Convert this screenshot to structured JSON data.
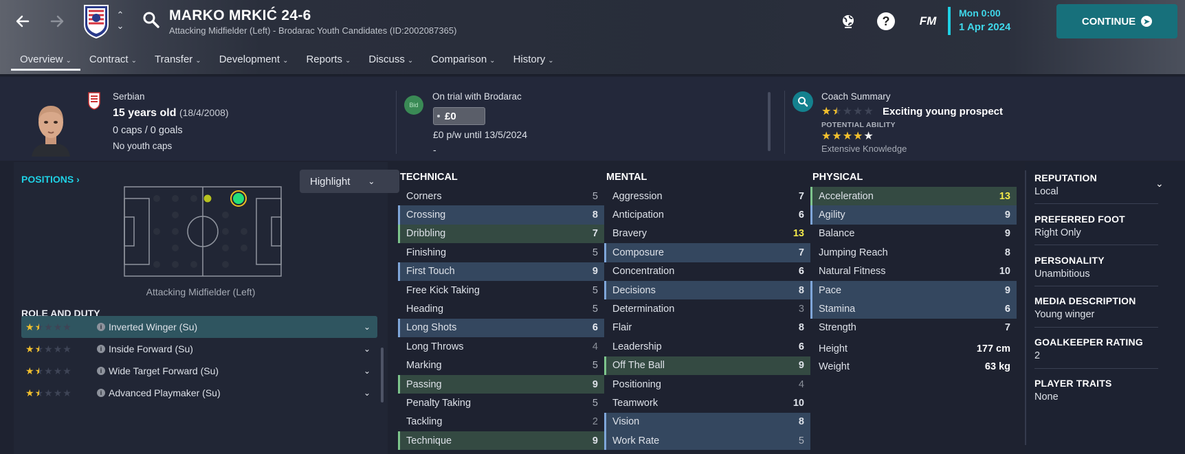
{
  "header": {
    "player_name": "MARKO MRKIĆ 24-6",
    "player_subtitle": "Attacking Midfielder (Left) - Brodarac Youth Candidates (ID:2002087365)",
    "date_day": "Mon 0:00",
    "date_date": "1 Apr 2024",
    "continue_label": "CONTINUE",
    "fm_label": "FM",
    "help_label": "?"
  },
  "tabs": [
    {
      "label": "Overview"
    },
    {
      "label": "Contract"
    },
    {
      "label": "Transfer"
    },
    {
      "label": "Development"
    },
    {
      "label": "Reports"
    },
    {
      "label": "Discuss"
    },
    {
      "label": "Comparison"
    },
    {
      "label": "History"
    }
  ],
  "info": {
    "nationality": "Serbian",
    "age": "15 years old",
    "dob": "(18/4/2008)",
    "caps": "0 caps / 0 goals",
    "youth_caps": "No youth caps",
    "bid_label": "Bid",
    "trial": "On trial with Brodarac",
    "fee": "£0",
    "wage": "£0 p/w until 13/5/2024",
    "dash": "-",
    "coach_title": "Coach Summary",
    "current_ability_text": "Exciting young prospect",
    "current_ability_stars": 1.5,
    "potential_label": "POTENTIAL ABILITY",
    "potential_stars": 4,
    "knowledge": "Extensive Knowledge"
  },
  "positions": {
    "link_label": "POSITIONS",
    "highlight_label": "Highlight",
    "caption": "Attacking Midfielder (Left)",
    "role_title": "ROLE AND DUTY",
    "roles": [
      {
        "name": "Inverted Winger (Su)",
        "stars": 1.5
      },
      {
        "name": "Inside Forward (Su)",
        "stars": 1.5
      },
      {
        "name": "Wide Target Forward (Su)",
        "stars": 1.5
      },
      {
        "name": "Advanced Playmaker (Su)",
        "stars": 1.5
      }
    ]
  },
  "technical": {
    "title": "TECHNICAL",
    "attrs": [
      {
        "name": "Corners",
        "value": "5",
        "hl": ""
      },
      {
        "name": "Crossing",
        "value": "8",
        "hl": "b"
      },
      {
        "name": "Dribbling",
        "value": "7",
        "hl": "g"
      },
      {
        "name": "Finishing",
        "value": "5",
        "hl": ""
      },
      {
        "name": "First Touch",
        "value": "9",
        "hl": "b"
      },
      {
        "name": "Free Kick Taking",
        "value": "5",
        "hl": ""
      },
      {
        "name": "Heading",
        "value": "5",
        "hl": ""
      },
      {
        "name": "Long Shots",
        "value": "6",
        "hl": "b"
      },
      {
        "name": "Long Throws",
        "value": "4",
        "hl": ""
      },
      {
        "name": "Marking",
        "value": "5",
        "hl": ""
      },
      {
        "name": "Passing",
        "value": "9",
        "hl": "g"
      },
      {
        "name": "Penalty Taking",
        "value": "5",
        "hl": ""
      },
      {
        "name": "Tackling",
        "value": "2",
        "hl": ""
      },
      {
        "name": "Technique",
        "value": "9",
        "hl": "g"
      }
    ]
  },
  "mental": {
    "title": "MENTAL",
    "attrs": [
      {
        "name": "Aggression",
        "value": "7",
        "hl": ""
      },
      {
        "name": "Anticipation",
        "value": "6",
        "hl": ""
      },
      {
        "name": "Bravery",
        "value": "13",
        "hl": ""
      },
      {
        "name": "Composure",
        "value": "7",
        "hl": "b"
      },
      {
        "name": "Concentration",
        "value": "6",
        "hl": ""
      },
      {
        "name": "Decisions",
        "value": "8",
        "hl": "b"
      },
      {
        "name": "Determination",
        "value": "3",
        "hl": ""
      },
      {
        "name": "Flair",
        "value": "8",
        "hl": ""
      },
      {
        "name": "Leadership",
        "value": "6",
        "hl": ""
      },
      {
        "name": "Off The Ball",
        "value": "9",
        "hl": "g"
      },
      {
        "name": "Positioning",
        "value": "4",
        "hl": ""
      },
      {
        "name": "Teamwork",
        "value": "10",
        "hl": ""
      },
      {
        "name": "Vision",
        "value": "8",
        "hl": "b"
      },
      {
        "name": "Work Rate",
        "value": "5",
        "hl": "b"
      }
    ]
  },
  "physical": {
    "title": "PHYSICAL",
    "attrs": [
      {
        "name": "Acceleration",
        "value": "13",
        "hl": "g"
      },
      {
        "name": "Agility",
        "value": "9",
        "hl": "b"
      },
      {
        "name": "Balance",
        "value": "9",
        "hl": ""
      },
      {
        "name": "Jumping Reach",
        "value": "8",
        "hl": ""
      },
      {
        "name": "Natural Fitness",
        "value": "10",
        "hl": ""
      },
      {
        "name": "Pace",
        "value": "9",
        "hl": "b"
      },
      {
        "name": "Stamina",
        "value": "6",
        "hl": "b"
      },
      {
        "name": "Strength",
        "value": "7",
        "hl": ""
      }
    ],
    "height_label": "Height",
    "height": "177 cm",
    "weight_label": "Weight",
    "weight": "63 kg"
  },
  "profile": {
    "reputation_label": "REPUTATION",
    "reputation": "Local",
    "foot_label": "PREFERRED FOOT",
    "foot": "Right Only",
    "personality_label": "PERSONALITY",
    "personality": "Unambitious",
    "media_label": "MEDIA DESCRIPTION",
    "media": "Young winger",
    "gk_label": "GOALKEEPER RATING",
    "gk": "2",
    "traits_label": "PLAYER TRAITS",
    "traits": "None"
  },
  "colors": {
    "accent": "#1fd0e4",
    "continue_bg": "#17707b",
    "star": "#f2c02e",
    "highlight_value": "#f2e84a",
    "blue_row": "#34475f",
    "green_row": "#344a42"
  },
  "icons": [
    "back-arrow-icon",
    "forward-arrow-icon",
    "club-badge-icon",
    "search-icon",
    "globe-icon",
    "help-icon",
    "continue-arrow-icon",
    "serbia-flag-icon",
    "magnifier-icon",
    "info-icon",
    "chevron-down-icon"
  ]
}
